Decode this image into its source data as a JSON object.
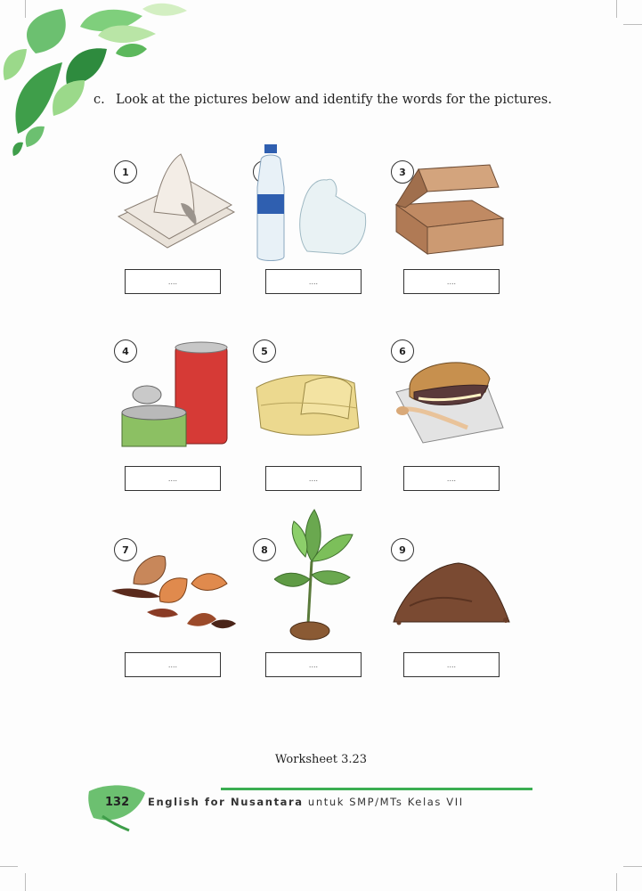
{
  "instruction": {
    "letter": "c.",
    "text": "Look at the pictures below and identify the words for the pictures."
  },
  "items": [
    {
      "number": "1",
      "answer": "...."
    },
    {
      "number": "2",
      "answer": "...."
    },
    {
      "number": "3",
      "answer": "...."
    },
    {
      "number": "4",
      "answer": "...."
    },
    {
      "number": "5",
      "answer": "...."
    },
    {
      "number": "6",
      "answer": "...."
    },
    {
      "number": "7",
      "answer": "...."
    },
    {
      "number": "8",
      "answer": "...."
    },
    {
      "number": "9",
      "answer": "...."
    }
  ],
  "caption": "Worksheet 3.23",
  "footer": {
    "page_number": "132",
    "title_bold": "English for Nusantara",
    "title_rest": " untuk SMP/MTs Kelas VII"
  },
  "colors": {
    "accent_green": "#3bae52",
    "leaf_green": "#5cb85c"
  }
}
